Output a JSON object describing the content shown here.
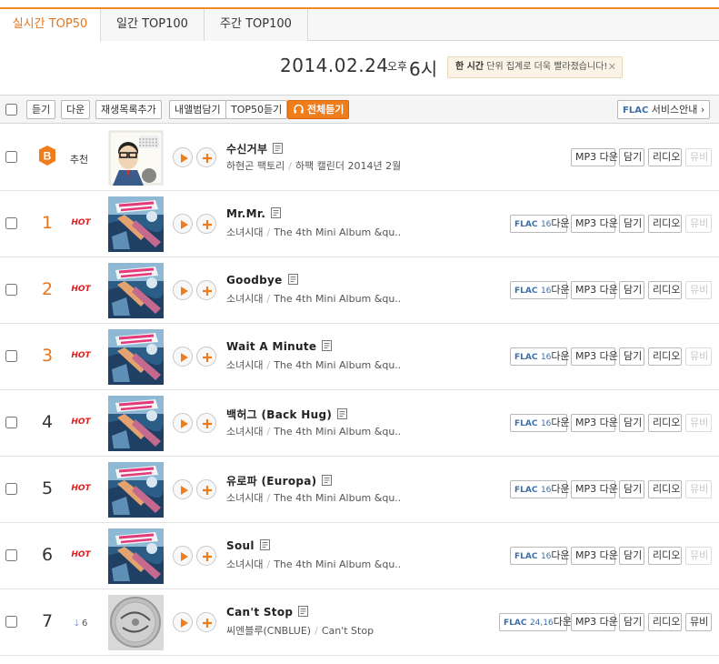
{
  "tabs": [
    {
      "label": "실시간 TOP50",
      "active": true
    },
    {
      "label": "일간 TOP100",
      "active": false
    },
    {
      "label": "주간 TOP100",
      "active": false
    }
  ],
  "dateline": {
    "date": "2014.02.24",
    "ampm": "오후",
    "hour": "6시",
    "notice_bold": "한 시간",
    "notice_text": " 단위 집계로 더욱 빨라졌습니다!",
    "notice_close": "✕"
  },
  "toolbar": {
    "listen": "듣기",
    "download": "다운",
    "add_playlist": "재생목록추가",
    "add_album": "내앨범담기",
    "top50_listen": "TOP50듣기",
    "listen_all": "전체듣기",
    "flac_label": "FLAC",
    "flac_guide": " 서비스안내 ›"
  },
  "buttons": {
    "flac": "FLAC",
    "down": "다운",
    "mp3": "MP3",
    "dam": "담기",
    "radio": "리디오",
    "mv": "뮤비"
  },
  "colors": {
    "accent": "#f08a24",
    "hot": "#e02020",
    "flac_blue": "#3d6ea8"
  },
  "rows": [
    {
      "rank": "",
      "badge": "b-badge-icon",
      "change": "추천",
      "title": "수신거부",
      "artist": "하현곤 팩토리",
      "album": "하팩 캘린더 2014년 2월",
      "flac": "",
      "mv_enabled": false,
      "cover": "calendar"
    },
    {
      "rank": "1",
      "change": "HOT",
      "title": "Mr.Mr.",
      "artist": "소녀시대",
      "album": "The 4th Mini Album &qu..",
      "flac": "16",
      "mv_enabled": false,
      "cover": "gg"
    },
    {
      "rank": "2",
      "change": "HOT",
      "title": "Goodbye",
      "artist": "소녀시대",
      "album": "The 4th Mini Album &qu..",
      "flac": "16",
      "mv_enabled": false,
      "cover": "gg"
    },
    {
      "rank": "3",
      "change": "HOT",
      "title": "Wait A Minute",
      "artist": "소녀시대",
      "album": "The 4th Mini Album &qu..",
      "flac": "16",
      "mv_enabled": false,
      "cover": "gg"
    },
    {
      "rank": "4",
      "change": "HOT",
      "title": "백허그 (Back Hug)",
      "artist": "소녀시대",
      "album": "The 4th Mini Album &qu..",
      "flac": "16",
      "mv_enabled": false,
      "cover": "gg"
    },
    {
      "rank": "5",
      "change": "HOT",
      "title": "유로파 (Europa)",
      "artist": "소녀시대",
      "album": "The 4th Mini Album &qu..",
      "flac": "16",
      "mv_enabled": false,
      "cover": "gg"
    },
    {
      "rank": "6",
      "change": "HOT",
      "title": "Soul",
      "artist": "소녀시대",
      "album": "The 4th Mini Album &qu..",
      "flac": "16",
      "mv_enabled": false,
      "cover": "gg"
    },
    {
      "rank": "7",
      "change": "6",
      "change_dir": "down",
      "title": "Can't Stop",
      "artist": "씨엔블루(CNBLUE)",
      "album": "Can't Stop",
      "flac": "24,16",
      "mv_enabled": true,
      "cover": "cantstop"
    }
  ]
}
